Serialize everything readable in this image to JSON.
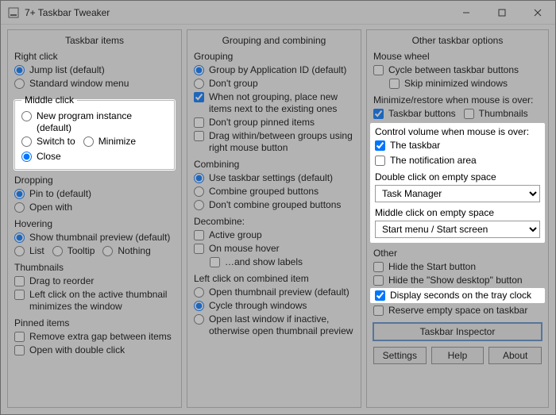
{
  "title": "7+ Taskbar Tweaker",
  "columns": {
    "col1_head": "Taskbar items",
    "col2_head": "Grouping and combining",
    "col3_head": "Other taskbar options"
  },
  "col1": {
    "right_click": "Right click",
    "rc_jump": "Jump list (default)",
    "rc_std": "Standard window menu",
    "middle_click": "Middle click",
    "mc_new": "New program instance (default)",
    "mc_switch": "Switch to",
    "mc_min": "Minimize",
    "mc_close": "Close",
    "dropping": "Dropping",
    "dr_pin": "Pin to (default)",
    "dr_open": "Open with",
    "hovering": "Hovering",
    "hv_thumb": "Show thumbnail preview (default)",
    "hv_list": "List",
    "hv_tooltip": "Tooltip",
    "hv_nothing": "Nothing",
    "thumbnails": "Thumbnails",
    "th_drag": "Drag to reorder",
    "th_left": "Left click on the active thumbnail minimizes the window",
    "pinned": "Pinned items",
    "pi_gap": "Remove extra gap between items",
    "pi_dbl": "Open with double click"
  },
  "col2": {
    "grouping": "Grouping",
    "g_appid": "Group by Application ID (default)",
    "g_dont": "Don't group",
    "g_whennot": "When not grouping, place new items next to the existing ones",
    "g_dontpin": "Don't group pinned items",
    "g_drag": "Drag within/between groups using right mouse button",
    "combining": "Combining",
    "c_use": "Use taskbar settings (default)",
    "c_combine": "Combine grouped buttons",
    "c_dont": "Don't combine grouped buttons",
    "decombine": "Decombine:",
    "d_active": "Active group",
    "d_hover": "On mouse hover",
    "d_labels": "…and show labels",
    "leftclick": "Left click on combined item",
    "lc_open": "Open thumbnail preview (default)",
    "lc_cycle": "Cycle through windows",
    "lc_last": "Open last window if inactive, otherwise open thumbnail preview"
  },
  "col3": {
    "wheel": "Mouse wheel",
    "w_cycle": "Cycle between taskbar buttons",
    "w_skip": "Skip minimized windows",
    "minrest": "Minimize/restore when mouse is over:",
    "mr_taskbar": "Taskbar buttons",
    "mr_thumbs": "Thumbnails",
    "volume": "Control volume when mouse is over:",
    "v_taskbar": "The taskbar",
    "v_notify": "The notification area",
    "dblclick": "Double click on empty space",
    "dbl_value": "Task Manager",
    "midclick": "Middle click on empty space",
    "mid_value": "Start menu / Start screen",
    "other": "Other",
    "o_hidestart": "Hide the Start button",
    "o_hideshow": "Hide the \"Show desktop\" button",
    "o_seconds": "Display seconds on the tray clock",
    "o_reserve": "Reserve empty space on taskbar",
    "btn_inspector": "Taskbar Inspector",
    "btn_settings": "Settings",
    "btn_help": "Help",
    "btn_about": "About"
  }
}
